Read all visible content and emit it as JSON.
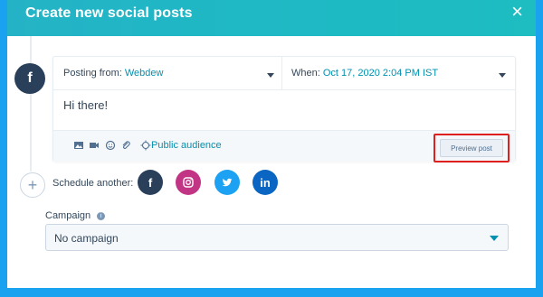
{
  "modal": {
    "title": "Create new social posts",
    "close_icon": "close-icon"
  },
  "post": {
    "posting_from_label": "Posting from:",
    "posting_from_value": "Webdew",
    "when_label": "When:",
    "when_value": "Oct 17, 2020 2:04 PM IST",
    "message": "Hi there!",
    "audience_label": "Public audience",
    "preview_button_label": "Preview post"
  },
  "schedule": {
    "label": "Schedule another:",
    "networks": [
      {
        "name": "facebook",
        "color": "#2a3f5a"
      },
      {
        "name": "instagram",
        "color": "#c13584"
      },
      {
        "name": "twitter",
        "color": "#1da1f2"
      },
      {
        "name": "linkedin",
        "color": "#0a66c2"
      }
    ]
  },
  "campaign": {
    "label": "Campaign",
    "selected": "No campaign"
  },
  "colors": {
    "accent": "#0091ae",
    "highlight": "#e01f1f",
    "header": "#24b3c6"
  }
}
